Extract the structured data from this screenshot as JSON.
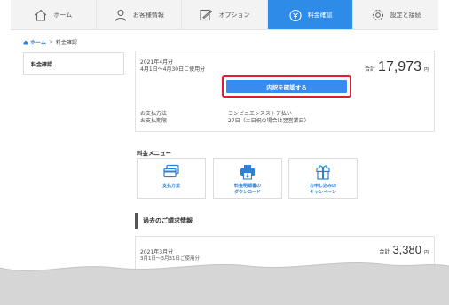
{
  "nav": {
    "tabs": [
      {
        "label": "ホーム",
        "icon": "home-icon",
        "active": false
      },
      {
        "label": "お客様情報",
        "icon": "person-icon",
        "active": false
      },
      {
        "label": "オプション",
        "icon": "edit-icon",
        "active": false
      },
      {
        "label": "料金確認",
        "icon": "bill-icon",
        "active": true
      },
      {
        "label": "設定と接続",
        "icon": "gear-icon",
        "active": false
      }
    ]
  },
  "breadcrumb": {
    "home": "ホーム",
    "separator": ">",
    "current": "料金確認"
  },
  "sidebar": {
    "item": "料金確認"
  },
  "current_bill": {
    "month": "2021年4月分",
    "range": "4月1日～4月30日ご使用分",
    "total_label": "合計",
    "amount": "17,973",
    "yen": "円",
    "detail_button": "内訳を確認する",
    "payment_method_label": "お支払方法",
    "payment_method_value": "コンビニエンスストア払い",
    "payment_due_label": "お支払期限",
    "payment_due_value": "27日（土日祝の場合は翌営業日）"
  },
  "fee_menu": {
    "title": "料金メニュー",
    "items": [
      {
        "label": "支払方法",
        "icon": "credit-card-icon"
      },
      {
        "label": "料金明細書の\nダウンロード",
        "icon": "printer-download-icon"
      },
      {
        "label": "お申し込みの\nキャンペーン",
        "icon": "gift-icon"
      }
    ]
  },
  "past_bills": {
    "title": "過去のご請求情報",
    "items": [
      {
        "month": "2021年3月分",
        "range": "3月1日～3月31日ご使用分",
        "total_label": "合計",
        "amount": "3,380",
        "yen": "円"
      }
    ]
  },
  "colors": {
    "accent": "#2e8be8",
    "button": "#3a8bf0",
    "highlight": "#e01b34",
    "link": "#2e7fd6"
  }
}
